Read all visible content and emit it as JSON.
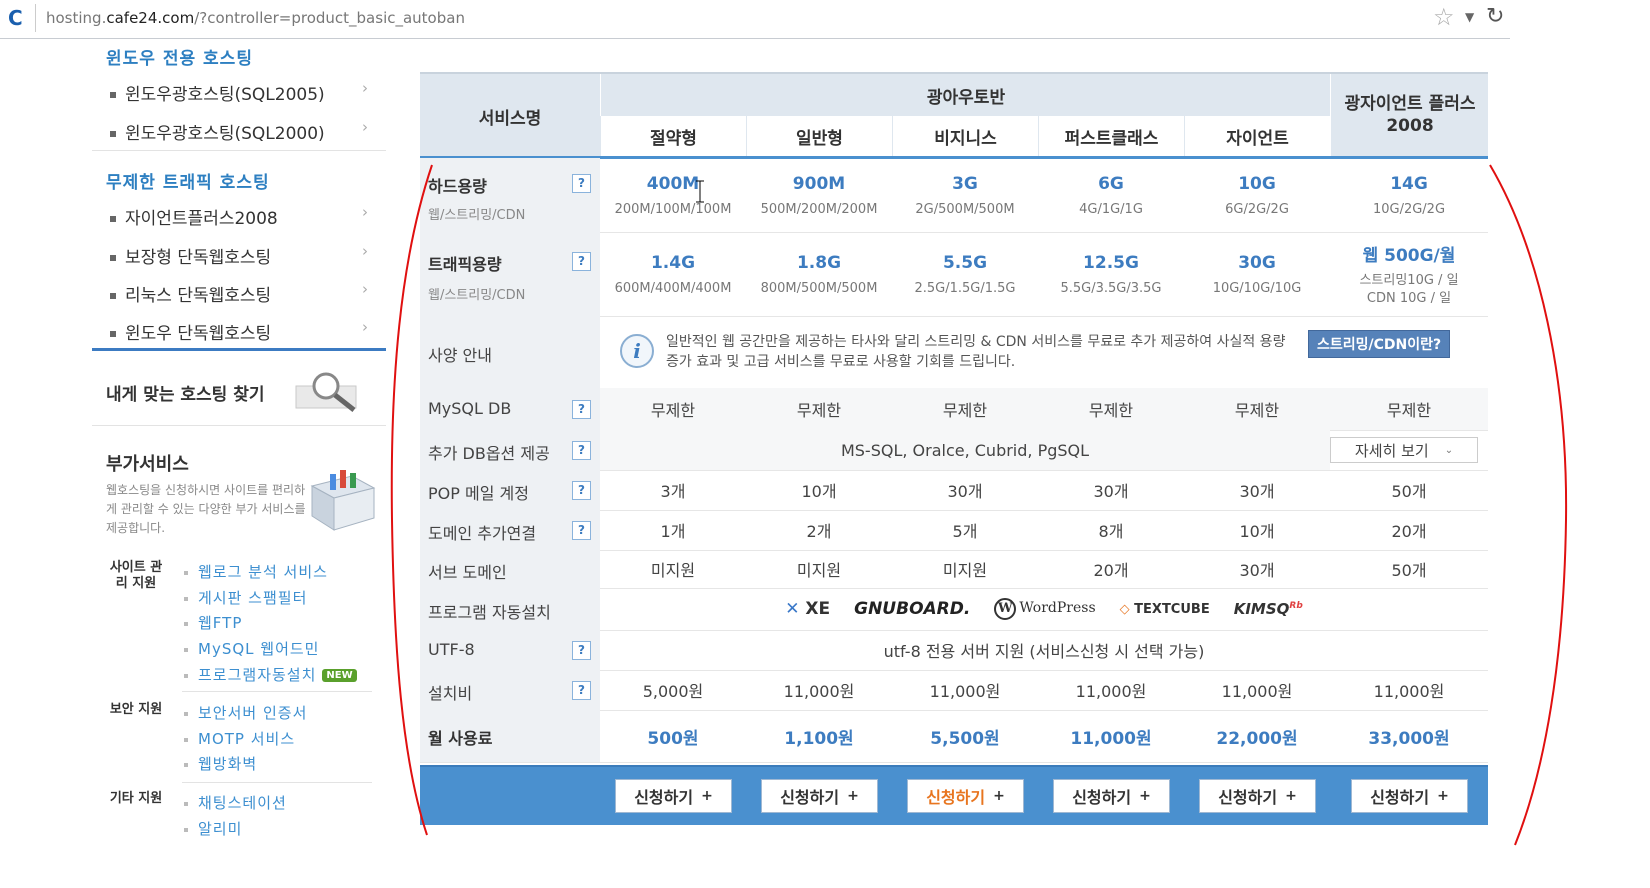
{
  "browser": {
    "url_prefix": "hosting.",
    "url_domain": "cafe24.com",
    "url_path": "/?controller=product_basic_autoban"
  },
  "sidebar": {
    "windows_title": "윈도우 전용 호스팅",
    "windows_items": [
      "윈도우광호스팅(SQL2005)",
      "윈도우광호스팅(SQL2000)"
    ],
    "unlimited_title": "무제한 트래픽 호스팅",
    "unlimited_items": [
      "자이언트플러스2008",
      "보장형 단독웹호스팅",
      "리눅스 단독웹호스팅",
      "윈도우 단독웹호스팅"
    ],
    "find_hosting": "내게 맞는 호스팅 찾기",
    "addon_title": "부가서비스",
    "addon_desc": "웹호스팅을 신청하시면 사이트를 편리하게 관리할 수 있는 다양한 부가 서비스를 제공합니다.",
    "groups": [
      {
        "label": "사이트 관리 지원",
        "items": [
          "웹로그 분석 서비스",
          "게시판 스팸필터",
          "웹FTP",
          "MySQL 웹어드민",
          "프로그램자동설치"
        ]
      },
      {
        "label": "보안 지원",
        "items": [
          "보안서버 인증서",
          "MOTP 서비스",
          "웹방화벽"
        ]
      },
      {
        "label": "기타 지원",
        "items": [
          "채팅스테이션",
          "알리미"
        ]
      }
    ],
    "new_badge": "NEW"
  },
  "table": {
    "service_name_header": "서비스명",
    "group_header": "광아우토반",
    "plans": [
      "절약형",
      "일반형",
      "비지니스",
      "퍼스트클래스",
      "자이언트"
    ],
    "last_plan": "광자이언트 플러스2008",
    "help_mark": "?",
    "disk": {
      "label": "하드용량",
      "sub": "웹/스트리밍/CDN",
      "values": [
        "400M",
        "900M",
        "3G",
        "6G",
        "10G",
        "14G"
      ],
      "subs": [
        "200M/100M/100M",
        "500M/200M/200M",
        "2G/500M/500M",
        "4G/1G/1G",
        "6G/2G/2G",
        "10G/2G/2G"
      ]
    },
    "traffic": {
      "label": "트래픽용량",
      "sub": "웹/스트리밍/CDN",
      "values": [
        "1.4G",
        "1.8G",
        "5.5G",
        "12.5G",
        "30G",
        "웹 500G/월"
      ],
      "subs": [
        "600M/400M/400M",
        "800M/500M/500M",
        "2.5G/1.5G/1.5G",
        "5.5G/3.5G/3.5G",
        "10G/10G/10G",
        "스트리밍10G / 일 CDN 10G / 일"
      ]
    },
    "spec": {
      "label": "사양 안내",
      "notice": "일반적인 웹 공간만을 제공하는 타사와 달리 스트리밍 & CDN 서비스를 무료로 추가 제공하여 사실적 용량증가 효과 및 고급 서비스를 무료로 사용할 기회를 드립니다.",
      "cdn_button": "스트리밍/CDN이란?"
    },
    "mysql": {
      "label": "MySQL DB",
      "values": [
        "무제한",
        "무제한",
        "무제한",
        "무제한",
        "무제한",
        "무제한"
      ]
    },
    "extra_db": {
      "label": "추가 DB옵션 제공",
      "text": "MS-SQL, Oralce, Cubrid, PgSQL",
      "detail": "자세히 보기"
    },
    "pop": {
      "label": "POP 메일 계정",
      "values": [
        "3개",
        "10개",
        "30개",
        "30개",
        "30개",
        "50개"
      ]
    },
    "domain": {
      "label": "도메인 추가연결",
      "values": [
        "1개",
        "2개",
        "5개",
        "8개",
        "10개",
        "20개"
      ]
    },
    "subdomain": {
      "label": "서브 도메인",
      "values": [
        "미지원",
        "미지원",
        "미지원",
        "20개",
        "30개",
        "50개"
      ]
    },
    "autoinstall": {
      "label": "프로그램 자동설치",
      "logos": [
        "XE",
        "GNUBOARD.",
        "WordPress",
        "TEXTCUBE",
        "KIMSQ"
      ]
    },
    "utf8": {
      "label": "UTF-8",
      "text": "utf-8 전용 서버 지원 (서비스신청 시 선택 가능)"
    },
    "setup": {
      "label": "설치비",
      "values": [
        "5,000원",
        "11,000원",
        "11,000원",
        "11,000원",
        "11,000원",
        "11,000원"
      ]
    },
    "monthly": {
      "label": "월 사용료",
      "values": [
        "500원",
        "1,100원",
        "5,500원",
        "11,000원",
        "22,000원",
        "33,000원"
      ]
    },
    "apply_label": "신청하기",
    "apply_plus": "+"
  },
  "colors": {
    "accent": "#3d7cc0",
    "header_bg": "#dfe7ef",
    "footer_bg": "#4a90cf",
    "annotation": "#e01010"
  }
}
